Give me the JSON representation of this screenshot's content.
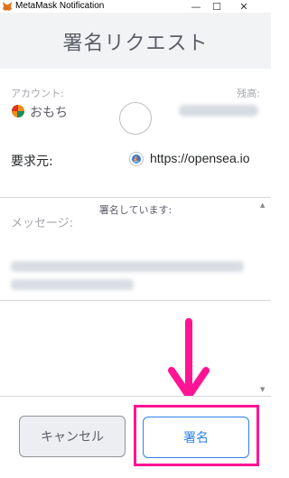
{
  "window": {
    "title": "MetaMask Notification",
    "minimize": "—",
    "maximize": "☐",
    "close": "✕"
  },
  "header": {
    "title": "署名リクエスト"
  },
  "account": {
    "label": "アカウント:",
    "name": "おもち",
    "balance_label": "残高:"
  },
  "origin": {
    "label": "要求元:",
    "url": "https://opensea.io",
    "icon": "opensea-icon"
  },
  "signing": {
    "text": "署名しています:"
  },
  "message": {
    "label": "メッセージ:"
  },
  "footer": {
    "cancel_label": "キャンセル",
    "sign_label": "署名"
  },
  "colors": {
    "accent": "#2f80ed",
    "highlight": "#ff1493",
    "header_bg": "#f2f3f4"
  }
}
